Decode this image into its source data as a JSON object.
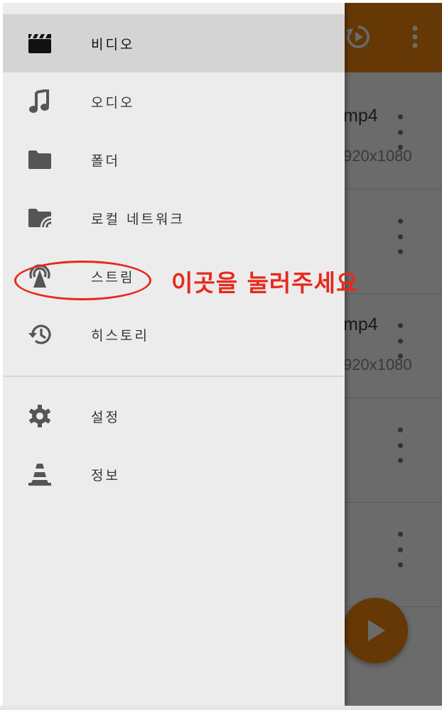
{
  "drawer": {
    "items": [
      {
        "label": "비디오",
        "icon": "video-clapper-icon",
        "selected": true
      },
      {
        "label": "오디오",
        "icon": "music-note-icon",
        "selected": false
      },
      {
        "label": "폴더",
        "icon": "folder-icon",
        "selected": false
      },
      {
        "label": "로컬 네트워크",
        "icon": "network-folder-icon",
        "selected": false
      },
      {
        "label": "스트림",
        "icon": "antenna-stream-icon",
        "selected": false
      },
      {
        "label": "히스토리",
        "icon": "history-icon",
        "selected": false
      }
    ],
    "secondary_items": [
      {
        "label": "설정",
        "icon": "gear-icon"
      },
      {
        "label": "정보",
        "icon": "vlc-cone-icon"
      }
    ]
  },
  "annotation": {
    "text": "이곳을 눌러주세요",
    "color": "#e8291c"
  },
  "background_app": {
    "toolbar_color": "#f0860c",
    "toolbar_icons": [
      "resume-playback-icon",
      "more-vert-icon"
    ],
    "videos": [
      {
        "title": "mp4",
        "resolution": "920x1080"
      },
      {
        "title": "",
        "resolution": ""
      },
      {
        "title": "mp4",
        "resolution": "920x1080"
      },
      {
        "title": "",
        "resolution": ""
      },
      {
        "title": "",
        "resolution": ""
      }
    ],
    "fab_icon": "play-icon"
  }
}
